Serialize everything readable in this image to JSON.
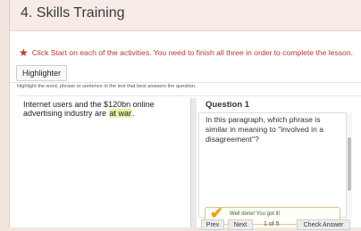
{
  "header": {
    "title": "4. Skills Training"
  },
  "instruction": {
    "text": "Click Start on each of the activities. You need to finish all three in order to complete the lesson."
  },
  "tabs": {
    "highlighter_label": "Highlighter"
  },
  "help": {
    "text": "Highlight the word, phrase or sentence in the text that best answers the question."
  },
  "passage": {
    "before": "Internet users and the $120bn online advertising industry are ",
    "highlight": "at war",
    "after": "."
  },
  "question": {
    "heading": "Question 1",
    "text": "In this paragraph, which phrase is similar in meaning to \"involved in a disagreement\"?"
  },
  "feedback": {
    "text": "Well done! You got it!"
  },
  "nav": {
    "prev_label": "Prev",
    "next_label": "Next",
    "counter": "1 of 5",
    "check_label": "Check Answer"
  },
  "icons": {
    "star": "star-icon",
    "check": "check-icon"
  },
  "colors": {
    "accent": "#b53a2f",
    "highlight": "#e7f3a7",
    "check": "#f0a11a"
  }
}
